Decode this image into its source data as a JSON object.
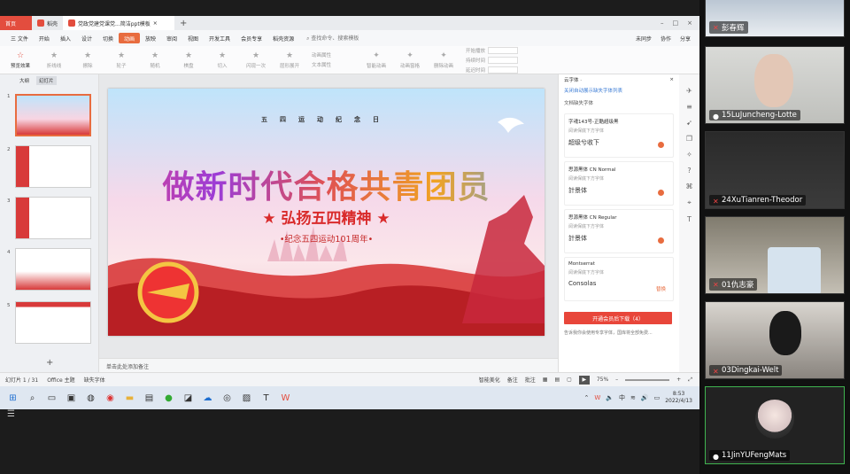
{
  "tabs": {
    "home": "首页",
    "second": "稻壳",
    "active": "党政党建党课党...简洁ppt模板",
    "plus": "+"
  },
  "menu": {
    "file": "三 文件",
    "items": [
      "开始",
      "插入",
      "设计",
      "切换",
      "动画",
      "放映",
      "审阅",
      "视图",
      "开发工具",
      "会员专享",
      "稻壳资源"
    ],
    "active_index": 4,
    "search": "查找命令、搜索模板",
    "right": [
      "未同步",
      "协作",
      "分享"
    ]
  },
  "ribbon": {
    "preview": "预览效果",
    "buttons": [
      "折线线",
      "擦除",
      "轮子",
      "随机",
      "棋盘",
      "切入",
      "闪现一次",
      "层形展开"
    ],
    "group1": [
      "动画属性",
      "文本属性"
    ],
    "buttons2": [
      "智能动画",
      "动画窗格",
      "删除动画"
    ],
    "fields": [
      {
        "label": "开始播放",
        "value": ""
      },
      {
        "label": "持续时间",
        "value": ""
      },
      {
        "label": "延迟时间",
        "value": ""
      }
    ]
  },
  "left_panel": {
    "tabs": [
      "大纲",
      "幻灯片"
    ],
    "slide_numbers": [
      "1",
      "2",
      "3",
      "4",
      "5"
    ],
    "add": "+"
  },
  "slide": {
    "top_text": "五四运动纪念日",
    "title": "做新时代合格共青团员",
    "subtitle": "★ 弘扬五四精神 ★",
    "caption": "•纪念五四运动101周年•"
  },
  "notes": {
    "placeholder": "单击此处添加备注"
  },
  "right_panel": {
    "header": "云字体 ·",
    "link": "关闭自动展示缺失字体列表",
    "section": "文档缺失字体",
    "fonts": [
      {
        "name": "字魂143号-正酷超级黑",
        "hint": "阅读保底下方字体",
        "sample": "超级兮收下",
        "action": ""
      },
      {
        "name": "思源黑体 CN Normal",
        "hint": "阅读保底下方字体",
        "sample": "計景体",
        "action": ""
      },
      {
        "name": "思源黑体 CN Regular",
        "hint": "阅读保底下方字体",
        "sample": "計景体",
        "action": ""
      },
      {
        "name": "Montserrat",
        "hint": "阅读保底下方字体",
        "sample": "Consolas",
        "action": "替换"
      }
    ],
    "download": "开通会员后下载（4）",
    "note": "告诉我你会使用专享字体，国库将全部免费..."
  },
  "status": {
    "page": "幻灯片 1 / 31",
    "theme": "Office 主题",
    "missing": "缺失字体",
    "beautify": "智能美化",
    "notes": "备注",
    "comments": "批注",
    "zoom": "75%"
  },
  "taskbar": {
    "time": "8:53",
    "date": "2022/4/13",
    "ime": "中"
  },
  "participants": [
    {
      "name": "彭春辉",
      "mic": "off"
    },
    {
      "name": "15LuJuncheng-Lotte",
      "mic": "on"
    },
    {
      "name": "24XuTianren-Theodor",
      "mic": "off"
    },
    {
      "name": "01仇志豪",
      "mic": "off"
    },
    {
      "name": "03Dingkai-Welt",
      "mic": "off"
    },
    {
      "name": "11JinYUFengMats",
      "mic": "on"
    }
  ],
  "colors": {
    "accent": "#e86c3f",
    "wps_red": "#e34d3e",
    "active_border": "#3fb34f"
  }
}
